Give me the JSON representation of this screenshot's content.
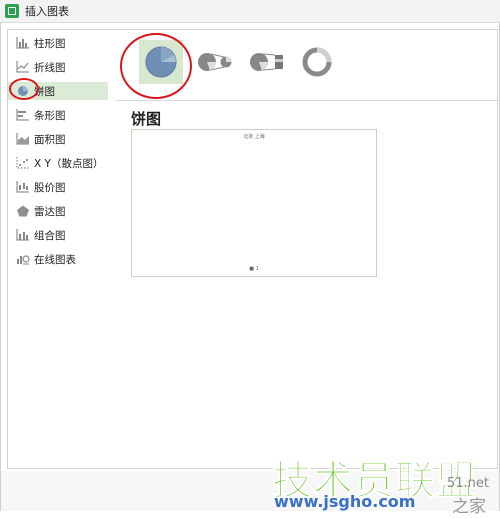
{
  "window": {
    "title": "插入图表"
  },
  "sidebar": {
    "items": [
      {
        "label": "柱形图",
        "icon": "bar-chart-icon"
      },
      {
        "label": "折线图",
        "icon": "line-chart-icon"
      },
      {
        "label": "饼图",
        "icon": "pie-chart-icon",
        "selected": true
      },
      {
        "label": "条形图",
        "icon": "horizontal-bar-icon"
      },
      {
        "label": "面积图",
        "icon": "area-chart-icon"
      },
      {
        "label": "X Y（散点图）",
        "icon": "scatter-chart-icon"
      },
      {
        "label": "股价图",
        "icon": "stock-chart-icon"
      },
      {
        "label": "雷达图",
        "icon": "radar-chart-icon"
      },
      {
        "label": "组合图",
        "icon": "combo-chart-icon"
      },
      {
        "label": "在线图表",
        "icon": "online-chart-icon"
      }
    ]
  },
  "subtypes": [
    {
      "name": "pie",
      "active": true
    },
    {
      "name": "pie-of-pie"
    },
    {
      "name": "bar-of-pie"
    },
    {
      "name": "doughnut"
    }
  ],
  "main": {
    "section_title": "饼图",
    "preview_title": "北京 上海",
    "preview_legend": "■ 1"
  },
  "watermark": {
    "text": "技术员联盟",
    "url": "www.jsgho.com",
    "side_top": "51.net",
    "side": "之家"
  },
  "colors": {
    "accent_selected": "#dcebd8",
    "annotation_red": "#d9181b",
    "pie_blue": "#6f8fb5",
    "watermark_green": "#5cc21a"
  }
}
